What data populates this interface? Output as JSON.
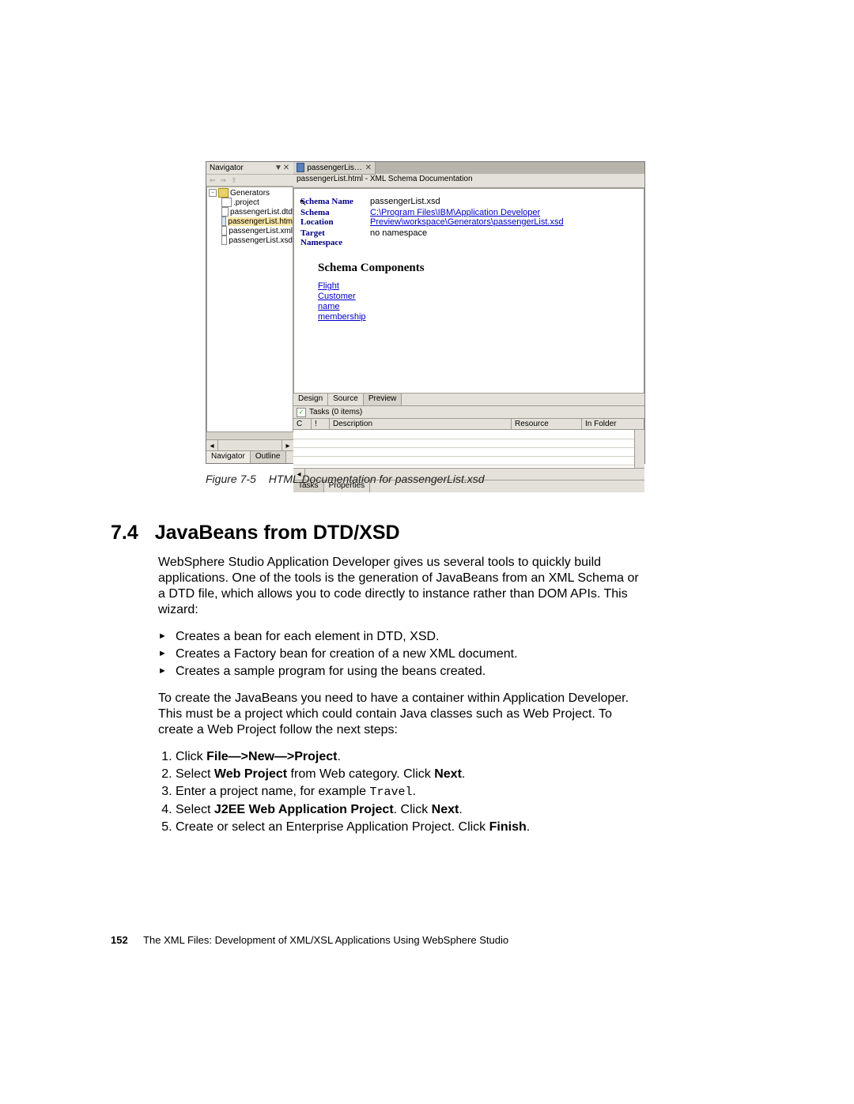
{
  "nav": {
    "title": "Navigator",
    "arrows": [
      "⇐",
      "⇒",
      "⇧"
    ],
    "tree_root": "Generators",
    "files": [
      {
        "label": ".project",
        "selected": false
      },
      {
        "label": "passengerList.dtd",
        "selected": false
      },
      {
        "label": "passengerList.htm",
        "selected": true
      },
      {
        "label": "passengerList.xml",
        "selected": false
      },
      {
        "label": "passengerList.xsd",
        "selected": false
      }
    ],
    "tabs": [
      "Navigator",
      "Outline"
    ]
  },
  "main": {
    "tab_label": "passengerList.html",
    "doc_title": "passengerList.html - XML Schema Documentation",
    "schema_name_label": "Schema Name",
    "schema_name_value": "passengerList.xsd",
    "schema_location_label_1": "Schema",
    "schema_location_label_2": "Location",
    "schema_location_line1": "C:\\Program Files\\IBM\\Application Developer",
    "schema_location_line2": "Preview\\workspace\\Generators\\passengerList.xsd",
    "target_ns_label_1": "Target",
    "target_ns_label_2": "Namespace",
    "target_ns_value": "no namespace",
    "components_heading": "Schema Components",
    "components": [
      "Flight",
      "Customer",
      "name",
      "membership"
    ],
    "doc_tabs": [
      "Design",
      "Source",
      "Preview"
    ]
  },
  "tasks": {
    "header": "Tasks (0 items)",
    "columns": [
      "C",
      "!",
      "Description",
      "Resource",
      "In Folder"
    ],
    "bottom_tabs": [
      "Tasks",
      "Properties"
    ]
  },
  "caption": {
    "num": "Figure 7-5",
    "text": "HTML Documentation for passengerList.xsd"
  },
  "section": {
    "num": "7.4",
    "title": "JavaBeans from DTD/XSD"
  },
  "para1": "WebSphere Studio Application Developer gives us several tools to quickly build applications. One of the tools is the generation of JavaBeans from an XML Schema or a DTD file, which allows you to code directly to instance rather than DOM APIs. This wizard:",
  "bullets": [
    "Creates a bean for each element in DTD, XSD.",
    "Creates a Factory bean for creation of a new XML document.",
    "Creates a sample program for using the beans created."
  ],
  "para2": "To create the JavaBeans you need to have a container within Application Developer. This must be a project which could contain Java classes such as Web Project. To create a Web Project follow the next steps:",
  "steps": {
    "s1_a": "Click ",
    "s1_b": "File—>New—>Project",
    "s1_c": ".",
    "s2_a": "Select ",
    "s2_b": "Web Project",
    "s2_c": " from Web category. Click ",
    "s2_d": "Next",
    "s2_e": ".",
    "s3_a": "Enter a project name, for example ",
    "s3_code": "Travel",
    "s3_b": ".",
    "s4_a": "Select ",
    "s4_b": "J2EE Web Application Project",
    "s4_c": ". Click ",
    "s4_d": "Next",
    "s4_e": ".",
    "s5_a": "Create or select an Enterprise Application Project. Click ",
    "s5_b": "Finish",
    "s5_c": "."
  },
  "footer": {
    "page": "152",
    "title": "The XML Files:  Development of XML/XSL Applications Using WebSphere Studio"
  }
}
